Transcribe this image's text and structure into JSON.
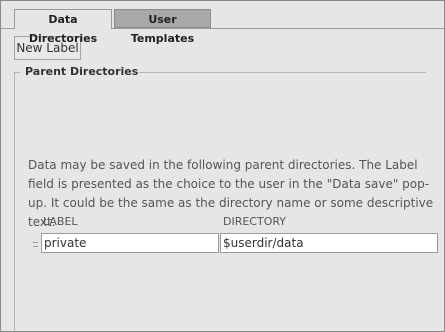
{
  "tabs": [
    {
      "label": "Data Directories",
      "active": true
    },
    {
      "label": "User Templates",
      "active": false
    }
  ],
  "toolbar": {
    "new_label_button": "New Label"
  },
  "group": {
    "title": "Parent Directories"
  },
  "description": "Data may be saved in the following parent directories. The Label field is presented as the choice to the user in the \"Data save\" pop-up. It could be the same as the directory name or some descriptive text.",
  "table": {
    "columns": {
      "label": "LABEL",
      "directory": "DIRECTORY"
    },
    "rows": [
      {
        "label": "private",
        "directory": "$userdir/data"
      }
    ]
  }
}
